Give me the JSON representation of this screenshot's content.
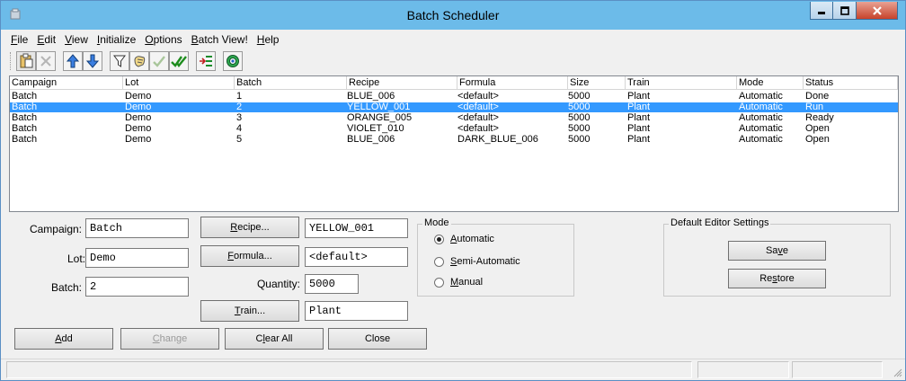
{
  "window": {
    "title": "Batch Scheduler"
  },
  "menu": [
    {
      "label": "File",
      "mnemonic": "F",
      "rest": "ile"
    },
    {
      "label": "Edit",
      "mnemonic": "E",
      "rest": "dit"
    },
    {
      "label": "View",
      "mnemonic": "V",
      "rest": "iew"
    },
    {
      "label": "Initialize",
      "mnemonic": "I",
      "rest": "nitialize"
    },
    {
      "label": "Options",
      "mnemonic": "O",
      "rest": "ptions"
    },
    {
      "label": "Batch View!",
      "mnemonic": "B",
      "rest": "atch View!"
    },
    {
      "label": "Help",
      "mnemonic": "H",
      "rest": "elp"
    }
  ],
  "toolbar": [
    {
      "icon": "clipboard-icon"
    },
    {
      "icon": "delete-x-icon"
    },
    {
      "icon": "move-up-icon"
    },
    {
      "icon": "move-down-icon"
    },
    {
      "icon": "filter-icon"
    },
    {
      "icon": "hand-icon"
    },
    {
      "icon": "check-icon"
    },
    {
      "icon": "double-check-icon"
    },
    {
      "icon": "list-arrow-icon"
    },
    {
      "icon": "target-icon"
    }
  ],
  "list": {
    "columns": [
      "Campaign",
      "Lot",
      "Batch",
      "Recipe",
      "Formula",
      "Size",
      "Train",
      "Mode",
      "Status"
    ],
    "rows": [
      [
        "Batch",
        "Demo",
        "1",
        "BLUE_006",
        "<default>",
        "5000",
        "Plant",
        "Automatic",
        "Done"
      ],
      [
        "Batch",
        "Demo",
        "2",
        "YELLOW_001",
        "<default>",
        "5000",
        "Plant",
        "Automatic",
        "Run"
      ],
      [
        "Batch",
        "Demo",
        "3",
        "ORANGE_005",
        "<default>",
        "5000",
        "Plant",
        "Automatic",
        "Ready"
      ],
      [
        "Batch",
        "Demo",
        "4",
        "VIOLET_010",
        "<default>",
        "5000",
        "Plant",
        "Automatic",
        "Open"
      ],
      [
        "Batch",
        "Demo",
        "5",
        "BLUE_006",
        "DARK_BLUE_006",
        "5000",
        "Plant",
        "Automatic",
        "Open"
      ]
    ],
    "selected_row": 1
  },
  "form": {
    "campaign_label": "Campaign:",
    "campaign_value": "Batch",
    "lot_label": "Lot:",
    "lot_value": "Demo",
    "batch_label": "Batch:",
    "batch_value": "2",
    "recipe_btn": {
      "mn": "R",
      "rest": "ecipe..."
    },
    "recipe_value": "YELLOW_001",
    "formula_btn": {
      "mn": "F",
      "rest": "ormula..."
    },
    "formula_value": "<default>",
    "quantity_label": "Quantity:",
    "quantity_value": "5000",
    "train_btn": {
      "mn": "T",
      "rest": "rain..."
    },
    "train_value": "Plant"
  },
  "mode": {
    "title": "Mode",
    "options": [
      {
        "mn": "A",
        "rest": "utomatic",
        "checked": true
      },
      {
        "mn": "S",
        "rest": "emi-Automatic",
        "checked": false
      },
      {
        "mn": "M",
        "rest": "anual",
        "checked": false
      }
    ]
  },
  "editor": {
    "title": "Default Editor Settings",
    "save_pre": "Sa",
    "save_mn": "v",
    "save_post": "e",
    "restore_pre": "Re",
    "restore_mn": "s",
    "restore_post": "tore"
  },
  "actions": {
    "add_mn": "A",
    "add_rest": "dd",
    "change_mn": "C",
    "change_rest": "hange",
    "clear_pre": "C",
    "clear_mn": "l",
    "clear_post": "ear All",
    "close": "Close"
  },
  "colors": {
    "selection": "#3399ff",
    "titlebar": "#6cbbe9"
  }
}
